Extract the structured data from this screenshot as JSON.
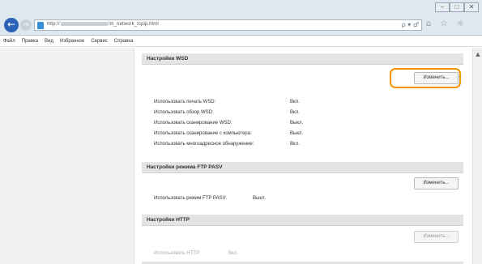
{
  "browser": {
    "url_prefix": "http://",
    "url_suffix": "/m_network_tcpip.html",
    "addr_tools": "ρ ▾ ♂",
    "right_icons": "⌂ ☆ ☼",
    "window_buttons": [
      "–",
      "□",
      "✕"
    ]
  },
  "menubar": {
    "items": [
      "Файл",
      "Правка",
      "Вид",
      "Избранное",
      "Сервис",
      "Справка"
    ]
  },
  "wsd": {
    "title": "Настройки WSD",
    "button_label": "Изменить...",
    "rows": [
      {
        "label": "Использовать печать WSD:",
        "value": "Вкл."
      },
      {
        "label": "Использовать обзор WSD:",
        "value": "Вкл."
      },
      {
        "label": "Использовать сканирование WSD:",
        "value": "Выкл."
      },
      {
        "label": "Использовать сканирование с компьютера:",
        "value": "Выкл."
      },
      {
        "label": "Использовать многоадресное обнаружение:",
        "value": "Вкл."
      }
    ]
  },
  "ftp": {
    "title": "Настройки режима FTP PASV",
    "button_label": "Изменить...",
    "rows": [
      {
        "label": "Использовать режим FTP PASV:",
        "value": "Выкл."
      }
    ]
  },
  "http": {
    "title": "Настройки HTTP",
    "button_label": "Изменить...",
    "rows": [
      {
        "label": "Использовать HTTP:",
        "value": "Вкл."
      }
    ]
  },
  "colors": {
    "highlight": "#f29400",
    "nav_blue": "#2a63b8"
  }
}
